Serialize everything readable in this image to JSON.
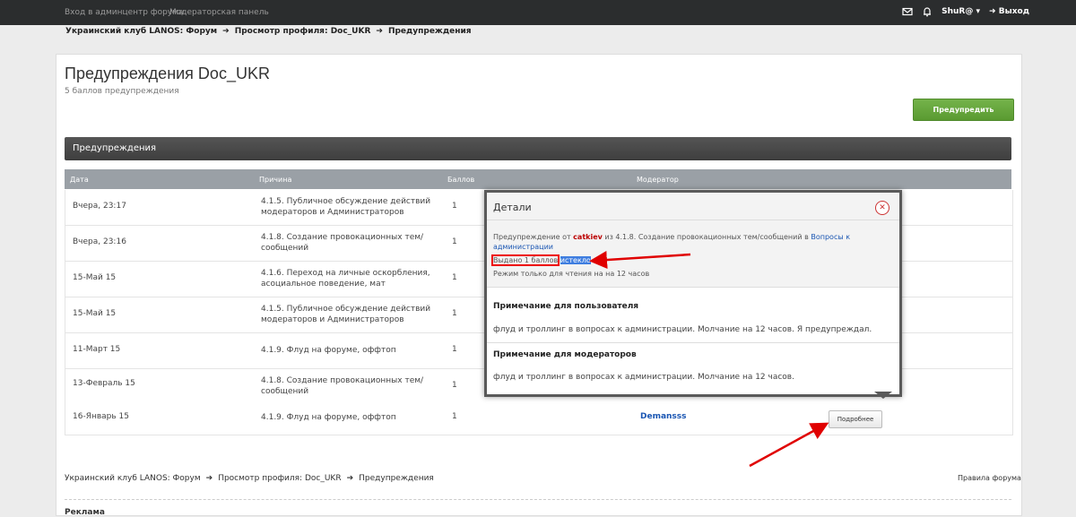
{
  "topbar": {
    "admin_link": "Вход в админцентр форума",
    "mod_link": "Модераторская панель",
    "user": "ShuR@",
    "logout": "Выход"
  },
  "breadcrumb": {
    "items": [
      "Украинский клуб LANOS: Форум",
      "Просмотр профиля: Doc_UKR",
      "Предупреждения"
    ]
  },
  "page": {
    "title": "Предупреждения Doc_UKR",
    "subtitle": "5 баллов предупреждения",
    "warn_button": "Предупредить",
    "section_title": "Предупреждения"
  },
  "table": {
    "headers": [
      "Дата",
      "Причина",
      "Баллов",
      "Модератор"
    ],
    "rows": [
      {
        "date": "Вчера, 23:17",
        "reason": "4.1.5. Публичное обсуждение действий модераторов и Администраторов",
        "points": "1"
      },
      {
        "date": "Вчера, 23:16",
        "reason": "4.1.8. Создание провокационных тем/сообщений",
        "points": "1"
      },
      {
        "date": "15-Май 15",
        "reason": "4.1.6. Переход на личные оскорбления, асоциальное поведение, мат",
        "points": "1"
      },
      {
        "date": "15-Май 15",
        "reason": "4.1.5. Публичное обсуждение действий модераторов и Администраторов",
        "points": "1"
      },
      {
        "date": "11-Март 15",
        "reason": "4.1.9. Флуд на форуме, оффтоп",
        "points": "1"
      },
      {
        "date": "13-Февраль 15",
        "reason": "4.1.8. Создание провокационных тем/сообщений",
        "points": "1"
      },
      {
        "date": "16-Январь 15",
        "reason": "4.1.9. Флуд на форуме, оффтоп",
        "points": "1",
        "moderator": "Demansss"
      }
    ],
    "more_button": "Подробнее"
  },
  "popup": {
    "title": "Детали",
    "line1_a": "Предупреждение от",
    "line1_user": "catkiev",
    "line1_b": "из 4.1.8. Создание провокационных тем/сообщений в",
    "line1_link": "Вопросы к администрации",
    "issued": "Выдано 1 баллов",
    "expired": "истекло",
    "readonly": "Режим только для чтения на на 12 часов",
    "user_note_title": "Примечание для пользователя",
    "user_note": "флуд и троллинг в вопросах к администрации. Молчание на 12 часов. Я предупреждал.",
    "mod_note_title": "Примечание для модераторов",
    "mod_note": "флуд и троллинг в вопросах к администрации. Молчание на 12 часов."
  },
  "footer": {
    "breadcrumb": [
      "Украинский клуб LANOS: Форум",
      "Просмотр профиля: Doc_UKR",
      "Предупреждения"
    ],
    "rules": "Правила форума",
    "ads": "Реклама"
  },
  "colors": {
    "accent_green": "#5a9a31",
    "link_blue": "#1a56b3",
    "annotation_red": "#e00000"
  }
}
